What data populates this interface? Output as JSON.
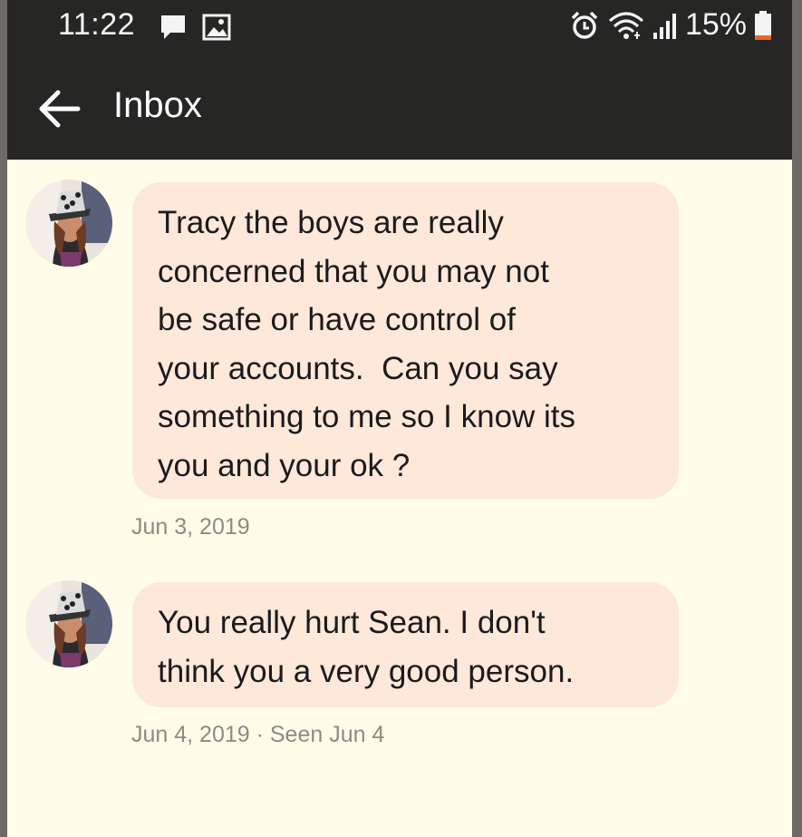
{
  "status_bar": {
    "time": "11:22",
    "left_icons": [
      "chat-bubble-icon",
      "image-icon"
    ],
    "right_icons": [
      "alarm-icon",
      "wifi-icon",
      "signal-icon",
      "battery-icon"
    ],
    "battery": "15%",
    "battery_level": 0.15,
    "battery_color": "#e8662a"
  },
  "header": {
    "back_icon": "arrow-left-icon",
    "title": "Inbox"
  },
  "messages": [
    {
      "lines": [
        "Tracy the boys are really",
        "concerned that you may not",
        "be safe or have control of",
        "your accounts.  Can you say",
        "something to me so I know its",
        "you and your ok ?"
      ],
      "meta": "Jun 3, 2019"
    },
    {
      "lines": [
        "You really hurt Sean. I don't",
        "think you a very good person."
      ],
      "meta": "Jun 4, 2019 · Seen Jun 4"
    }
  ],
  "colors": {
    "bar_background": "#262624",
    "screen_background": "#fffde8",
    "bubble_background": "#fde8da",
    "meta_text": "#8e8a84"
  }
}
